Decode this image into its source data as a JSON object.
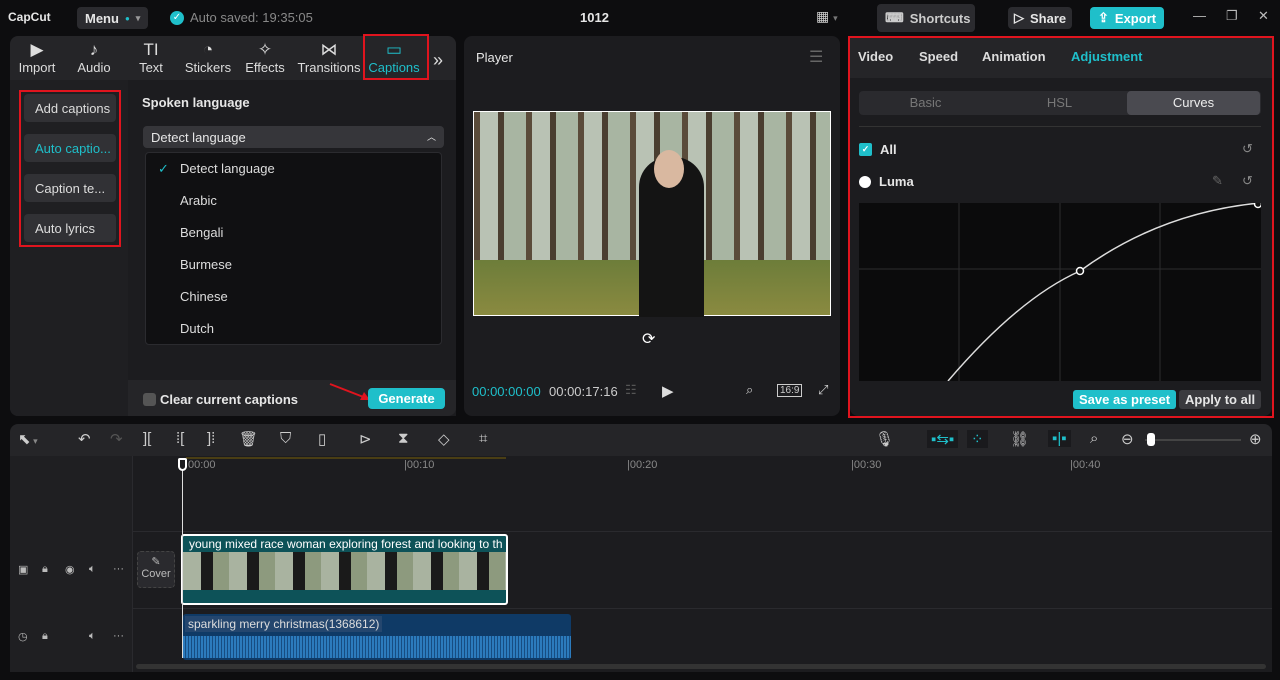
{
  "app": {
    "logo": "CapCut",
    "menu": "Menu",
    "autosave": "Auto saved: 19:35:05",
    "title": "1012",
    "shortcuts": "Shortcuts",
    "share": "Share",
    "export": "Export"
  },
  "media_tabs": [
    {
      "label": "Import",
      "icon": "▶"
    },
    {
      "label": "Audio",
      "icon": "♪"
    },
    {
      "label": "Text",
      "icon": "TI"
    },
    {
      "label": "Stickers",
      "icon": "◔"
    },
    {
      "label": "Effects",
      "icon": "✧"
    },
    {
      "label": "Transitions",
      "icon": "⋈"
    },
    {
      "label": "Captions",
      "icon": "▭"
    }
  ],
  "caption_menu": [
    "Add captions",
    "Auto captio...",
    "Caption te...",
    "Auto lyrics"
  ],
  "captions": {
    "spoken_language_label": "Spoken language",
    "selected": "Detect language",
    "options": [
      "Detect language",
      "Arabic",
      "Bengali",
      "Burmese",
      "Chinese",
      "Dutch"
    ],
    "clear_label": "Clear current captions",
    "generate": "Generate"
  },
  "player": {
    "title": "Player",
    "current_time": "00:00:00:00",
    "duration": "00:00:17:16",
    "ratio": "16:9"
  },
  "right": {
    "tabs": [
      "Video",
      "Speed",
      "Animation",
      "Adjustment"
    ],
    "active_tab": "Adjustment",
    "subtabs": [
      "Basic",
      "HSL",
      "Curves"
    ],
    "active_subtab": "Curves",
    "all_label": "All",
    "luma_label": "Luma",
    "save_preset": "Save as preset",
    "apply_all": "Apply to all"
  },
  "timeline": {
    "ruler": [
      "00:00",
      "|00:10",
      "|00:20",
      "|00:30",
      "|00:40"
    ],
    "cover": "Cover",
    "video_clip": "young mixed race woman exploring forest and looking to th",
    "audio_clip": "sparkling merry christmas(1368612)"
  },
  "colors": {
    "accent": "#1fbfca",
    "red": "#e0141e"
  }
}
